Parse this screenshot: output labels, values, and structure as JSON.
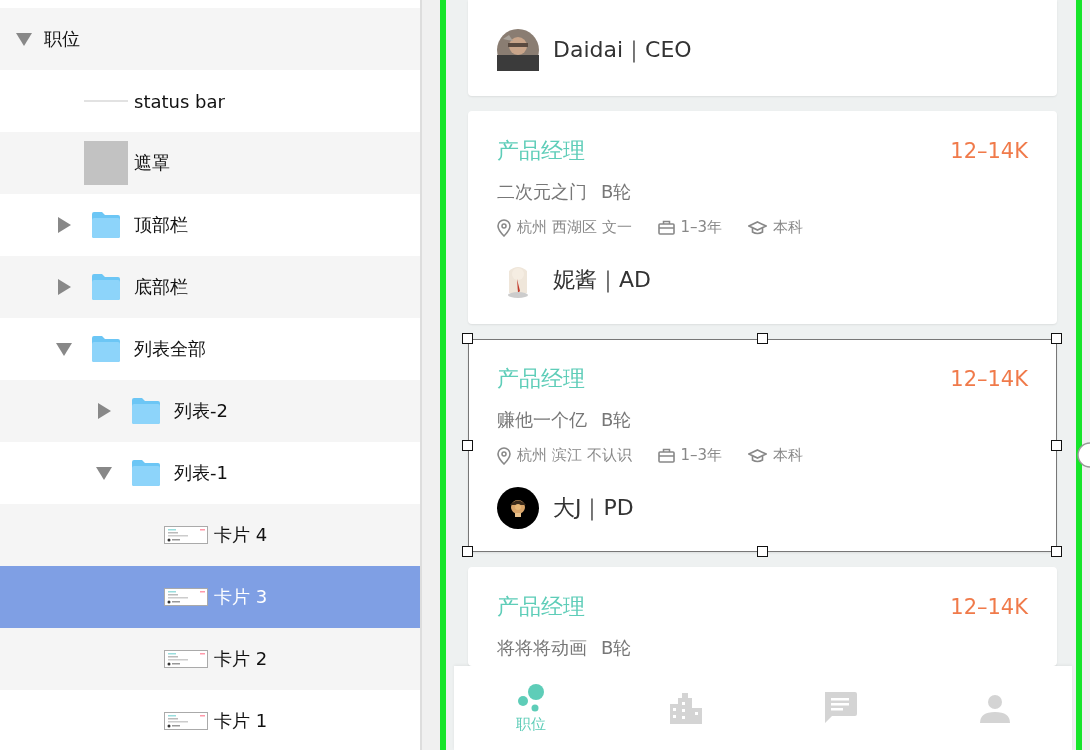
{
  "layers": [
    {
      "label": "职位",
      "expanded": true,
      "selected": false,
      "children": [
        {
          "label": "status bar",
          "kind": "line",
          "selected": false
        },
        {
          "label": "遮罩",
          "kind": "shape",
          "selected": false
        },
        {
          "label": "顶部栏",
          "kind": "folder",
          "expanded": false,
          "selected": false
        },
        {
          "label": "底部栏",
          "kind": "folder",
          "expanded": false,
          "selected": false
        },
        {
          "label": "列表全部",
          "kind": "folder",
          "expanded": true,
          "selected": false,
          "children": [
            {
              "label": "列表-2",
              "kind": "folder",
              "expanded": false,
              "selected": false
            },
            {
              "label": "列表-1",
              "kind": "folder",
              "expanded": true,
              "selected": false,
              "children": [
                {
                  "label": "卡片 4",
                  "kind": "card",
                  "selected": false
                },
                {
                  "label": "卡片 3",
                  "kind": "card",
                  "selected": true
                },
                {
                  "label": "卡片 2",
                  "kind": "card",
                  "selected": false
                },
                {
                  "label": "卡片 1",
                  "kind": "card",
                  "selected": false
                }
              ]
            }
          ]
        }
      ]
    }
  ],
  "cards": [
    {
      "person": "Daidai｜CEO",
      "selected": false
    },
    {
      "title": "产品经理",
      "salary": "12–14K",
      "company": "二次元之门",
      "round": "B轮",
      "location": "杭州 西湖区 文一",
      "experience": "1–3年",
      "education": "本科",
      "person": "妮酱｜AD",
      "selected": false
    },
    {
      "title": "产品经理",
      "salary": "12–14K",
      "company": "赚他一个亿",
      "round": "B轮",
      "location": "杭州 滨江 不认识",
      "experience": "1–3年",
      "education": "本科",
      "person": "大J｜PD",
      "selected": true
    },
    {
      "title": "产品经理",
      "salary": "12–14K",
      "company": "将将将动画",
      "round": "B轮",
      "selected": false
    }
  ],
  "tabs": [
    {
      "kind": "bubbles",
      "label": "职位",
      "selected": true
    },
    {
      "kind": "building",
      "selected": false
    },
    {
      "kind": "chat",
      "selected": false
    },
    {
      "kind": "person",
      "selected": false
    }
  ]
}
